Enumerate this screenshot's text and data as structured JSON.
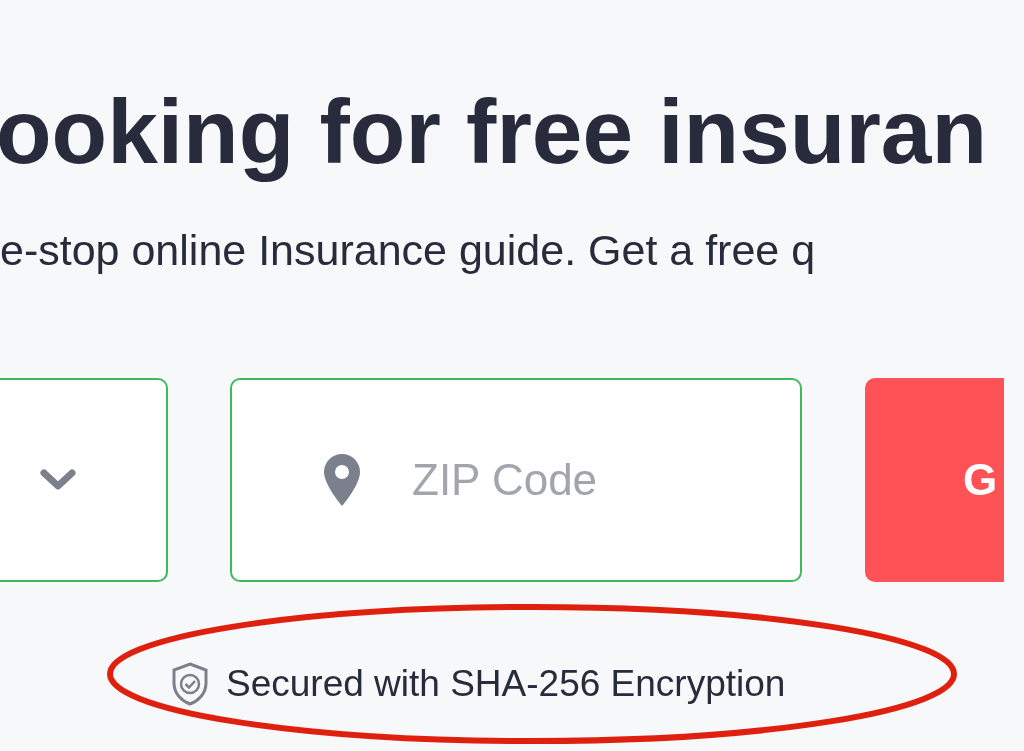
{
  "hero": {
    "heading": "ooking for free insuran",
    "subheading": "e-stop online Insurance guide. Get a free q"
  },
  "form": {
    "zip_field": {
      "placeholder": "ZIP Code"
    },
    "submit_button": {
      "label": "G"
    }
  },
  "security_note": {
    "text": "Secured with SHA-256 Encryption",
    "highlighted": true
  }
}
